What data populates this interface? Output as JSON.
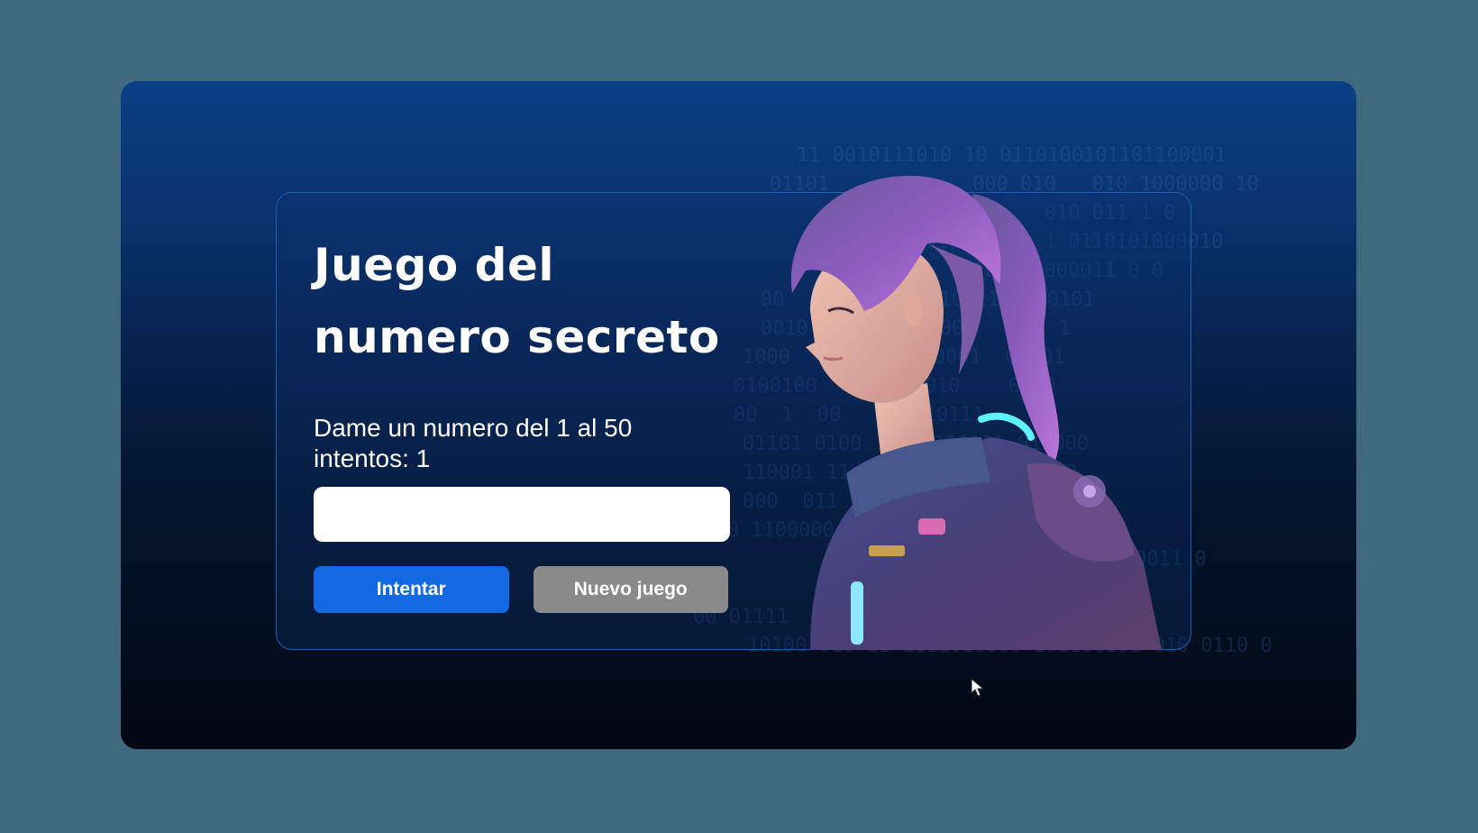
{
  "game": {
    "title_line1": "Juego del",
    "title_line2": "numero secreto",
    "prompt": "Dame un numero del 1 al 50",
    "attempts": "intentos: 1",
    "input_value": "",
    "try_button": "Intentar",
    "new_game_button": "Nuevo juego"
  },
  "background": {
    "binary_lines": [
      "11 0010111010 10 0110100101101100001",
      "01101      1     000 010   010 1000000 10",
      "          0 0110001    010 011 1 0",
      "           00010111    1 0110101000010",
      "           00  10100011000011 0 0",
      "00    00  1 01 10011   00101",
      "0010     011 1000    001 1",
      "1000      0110  0001  01101",
      "0100100     0111010    0100",
      "00  1  00      110111",
      "01101 0100   10 111111 011000",
      "110001 11       001101000110",
      "000  011      0111000 1010",
      "11010000 1100000  00011 1 0",
      "           0111000011 0",
      "00 01111         0101 11011",
      "10100 010 11 1111010000 101100101 010 0110 0"
    ]
  },
  "colors": {
    "primary_button": "#1269e2",
    "secondary_button": "#8a8a8a",
    "page_background": "#40687f"
  },
  "icons": {
    "cursor": "mouse-pointer-icon"
  }
}
